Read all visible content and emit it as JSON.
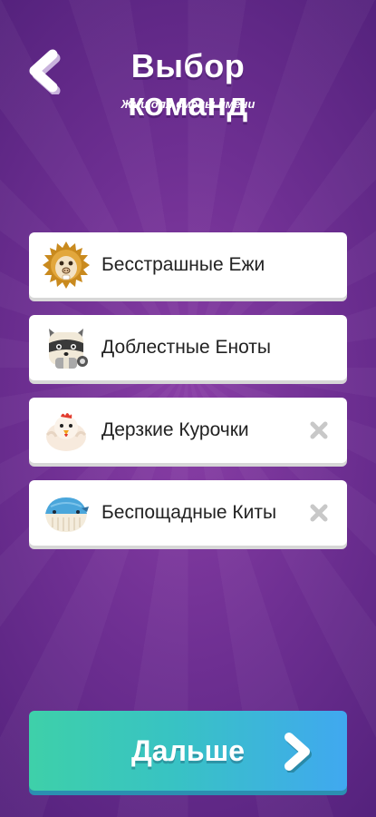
{
  "header": {
    "title": "Выбор команд",
    "subtitle": "Жми для смены имени",
    "back_icon": "back-chevron-icon"
  },
  "teams": [
    {
      "name": "Бесстрашные Ежи",
      "avatar": "hedgehog-icon",
      "removable": false
    },
    {
      "name": "Доблестные Еноты",
      "avatar": "raccoon-icon",
      "removable": false
    },
    {
      "name": "Дерзкие Курочки",
      "avatar": "chicken-icon",
      "removable": true
    },
    {
      "name": "Беспощадные Киты",
      "avatar": "whale-icon",
      "removable": true
    }
  ],
  "footer": {
    "next_label": "Дальше",
    "next_icon": "forward-chevron-icon"
  },
  "colors": {
    "background": "#6e2f92",
    "card": "#ffffff",
    "button_start": "#3ed0a9",
    "button_end": "#40a8f0",
    "remove_icon": "#c8c8c8"
  }
}
